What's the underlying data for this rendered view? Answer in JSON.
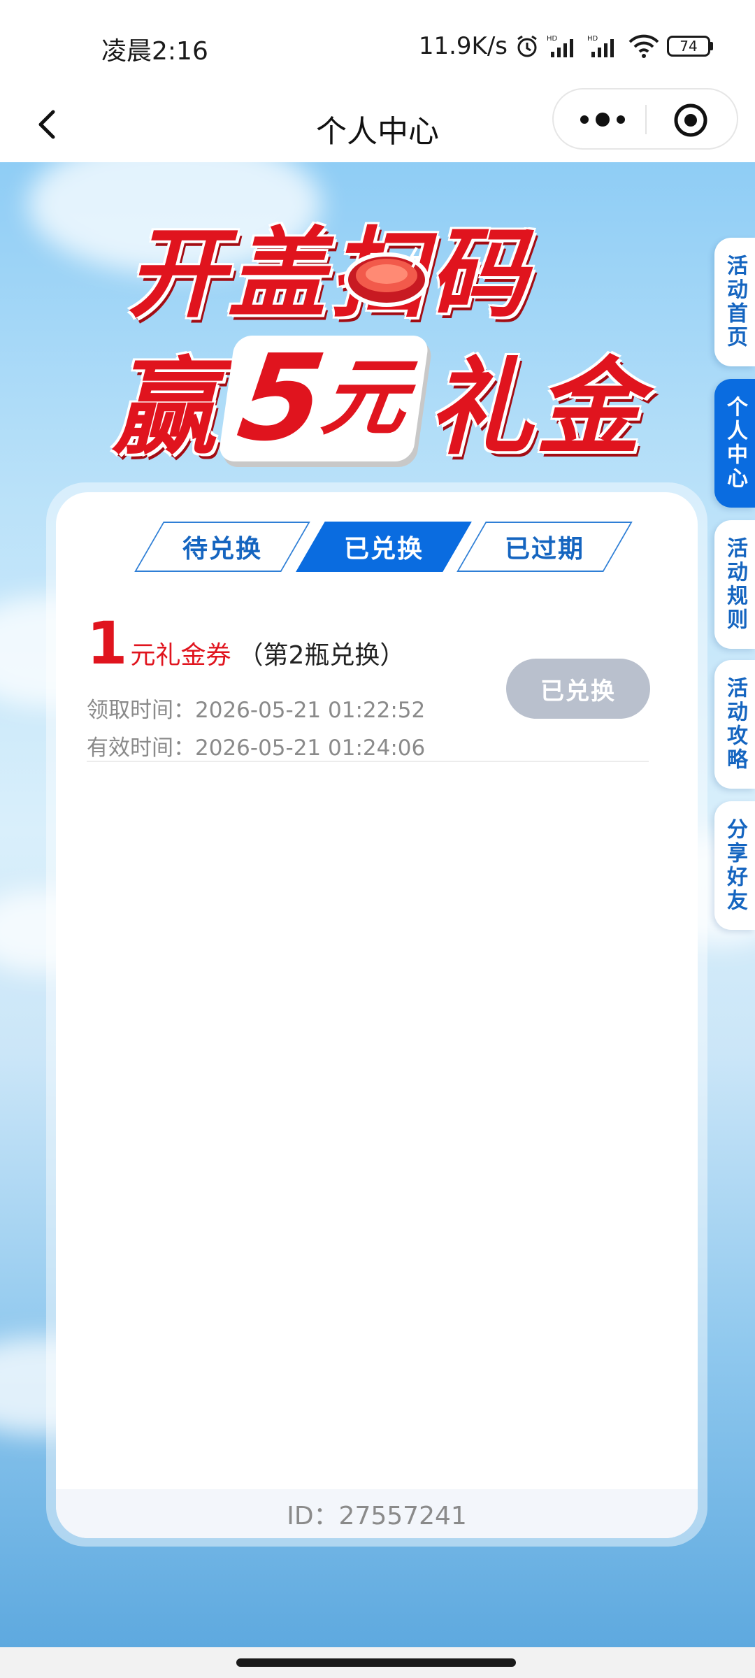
{
  "status_bar": {
    "time": "凌晨2:16",
    "net_speed": "11.9K/s",
    "battery": "74"
  },
  "nav": {
    "title": "个人中心"
  },
  "banner": {
    "line1": "开盖扫码",
    "line2_pre": "赢",
    "amount": "5",
    "unit": "元",
    "line2_post": "礼金"
  },
  "tabs": [
    {
      "label": "待兑换",
      "active": false
    },
    {
      "label": "已兑换",
      "active": true
    },
    {
      "label": "已过期",
      "active": false
    }
  ],
  "records": [
    {
      "amount": "1",
      "unit": "元礼金券",
      "note": "（第2瓶兑换）",
      "receive_time": "领取时间：2026-05-21 01:22:52",
      "valid_time": "有效时间：2026-05-21 01:24:06",
      "status_button": "已兑换"
    }
  ],
  "footer": {
    "id_text": "ID：27557241"
  },
  "side_tabs": [
    {
      "label": "活动首页",
      "active": false
    },
    {
      "label": "个人中心",
      "active": true
    },
    {
      "label": "活动规则",
      "active": false
    },
    {
      "label": "活动攻略",
      "active": false
    },
    {
      "label": "分享好友",
      "active": false
    }
  ],
  "colors": {
    "brand_blue": "#0a6ce0",
    "brand_red": "#e0141e",
    "disabled_gray": "#b9c0cd"
  }
}
